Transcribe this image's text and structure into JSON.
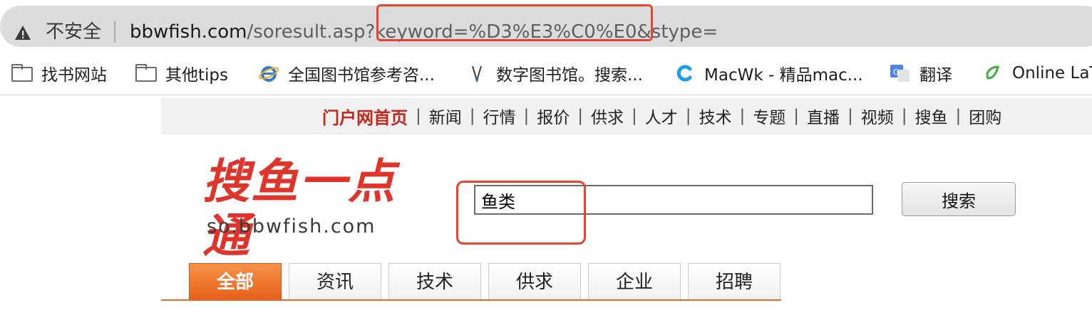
{
  "browser": {
    "security_label": "不安全",
    "url_host": "bbwfish.com",
    "url_path": "/soresult.asp?keyword=%D3%E3%C0%E0&stype="
  },
  "bookmarks": [
    {
      "label": "找书网站",
      "icon": "folder-icon"
    },
    {
      "label": "其他tips",
      "icon": "folder-icon"
    },
    {
      "label": "全国图书馆参考咨...",
      "icon": "ie-icon"
    },
    {
      "label": "数字图书馆。搜索...",
      "icon": "v-icon"
    },
    {
      "label": "MacWk - 精品mac...",
      "icon": "macwk-icon"
    },
    {
      "label": "翻译",
      "icon": "google-translate-icon"
    },
    {
      "label": "Online LaT",
      "icon": "overleaf-icon"
    }
  ],
  "portal_nav": {
    "home": "门户网首页",
    "separator": "|",
    "items": [
      "新闻",
      "行情",
      "报价",
      "供求",
      "人才",
      "技术",
      "专题",
      "直播",
      "视频",
      "搜鱼",
      "团购"
    ]
  },
  "logo": {
    "main_text": "搜鱼一点通",
    "sub_text": "so.bbwfish.com",
    "color": "#e0332a"
  },
  "search": {
    "value": "鱼类",
    "button_label": "搜索"
  },
  "tabs": [
    {
      "label": "全部",
      "active": true
    },
    {
      "label": "资讯",
      "active": false
    },
    {
      "label": "技术",
      "active": false
    },
    {
      "label": "供求",
      "active": false
    },
    {
      "label": "企业",
      "active": false
    },
    {
      "label": "招聘",
      "active": false
    }
  ],
  "colors": {
    "annotation": "#e8432e",
    "active_tab": "#e75f1a",
    "portal_home": "#c3261b"
  }
}
